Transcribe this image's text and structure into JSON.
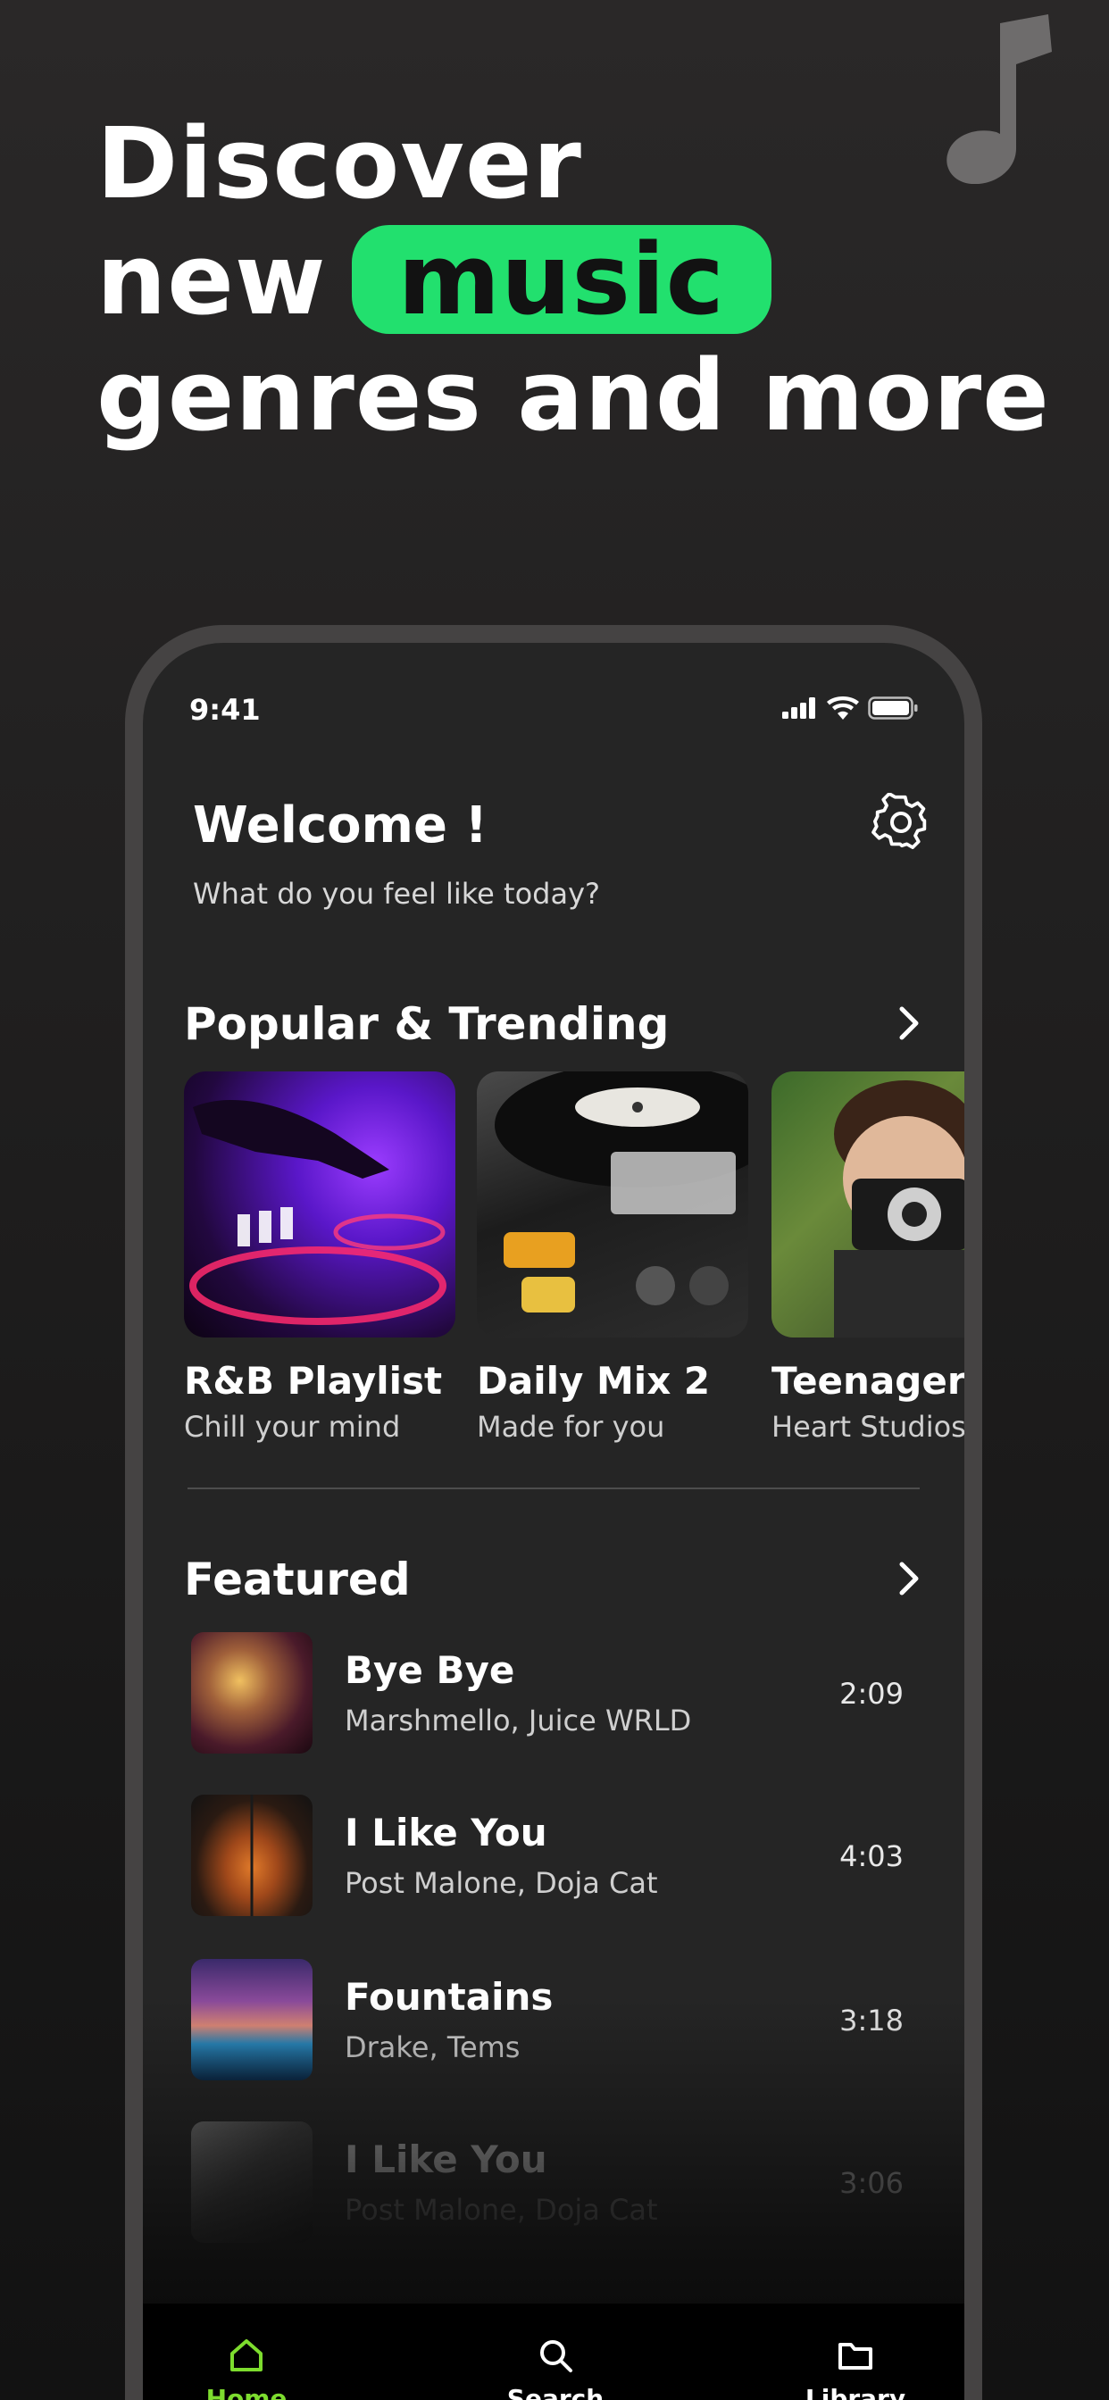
{
  "headline": {
    "line1": "Discover",
    "line2_prefix": "new",
    "line2_highlight": "music",
    "line3": "genres and more"
  },
  "status_bar": {
    "time": "9:41"
  },
  "header": {
    "welcome": "Welcome !",
    "subtitle": "What do you feel like today?"
  },
  "sections": {
    "popular_title": "Popular & Trending",
    "featured_title": "Featured"
  },
  "playlists": [
    {
      "title": "R&B Playlist",
      "subtitle": "Chill your mind"
    },
    {
      "title": "Daily Mix 2",
      "subtitle": "Made for you"
    },
    {
      "title": "Teenager Y",
      "subtitle": "Heart Studios"
    }
  ],
  "tracks": [
    {
      "title": "Bye Bye",
      "artist": "Marshmello, Juice WRLD",
      "duration": "2:09"
    },
    {
      "title": "I Like You",
      "artist": "Post Malone, Doja Cat",
      "duration": "4:03"
    },
    {
      "title": "Fountains",
      "artist": "Drake, Tems",
      "duration": "3:18"
    },
    {
      "title": "I Like You",
      "artist": "Post Malone, Doja Cat",
      "duration": "3:06"
    }
  ],
  "tabs": [
    {
      "label": "Home",
      "icon": "home-icon",
      "active": true
    },
    {
      "label": "Search",
      "icon": "search-icon",
      "active": false
    },
    {
      "label": "Library",
      "icon": "folder-icon",
      "active": false
    }
  ],
  "colors": {
    "accent": "#22e06e",
    "active_tab": "#7ddc2e",
    "screen_bg": "#252525",
    "phone_frame": "#454343"
  }
}
